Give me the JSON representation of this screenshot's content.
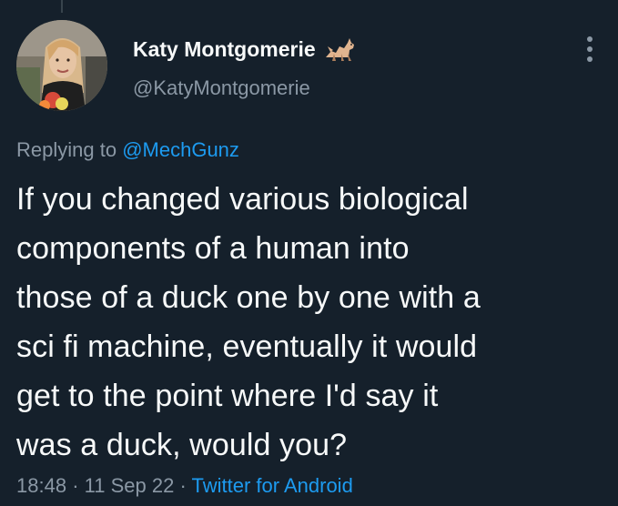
{
  "user": {
    "display_name": "Katy Montgomerie",
    "handle": "@KatyMontgomerie",
    "badge_icon": "cat-icon"
  },
  "reply": {
    "prefix": "Replying to",
    "mention": "@MechGunz"
  },
  "tweet": {
    "lines": [
      "If you changed various biological",
      "components of a human into",
      "those of a duck one by one with a",
      "sci fi machine, eventually it would",
      "get to the point where I'd say it",
      "was a duck, would you?"
    ]
  },
  "meta": {
    "time": "18:48",
    "separator_1": "·",
    "date": "11 Sep 22",
    "separator_2": "·",
    "source": "Twitter for Android"
  },
  "menu": {
    "icon": "more-options-icon"
  },
  "colors": {
    "background": "#15202b",
    "text": "#f7f9f9",
    "secondary": "#8b98a5",
    "accent": "#1d9bf0"
  }
}
